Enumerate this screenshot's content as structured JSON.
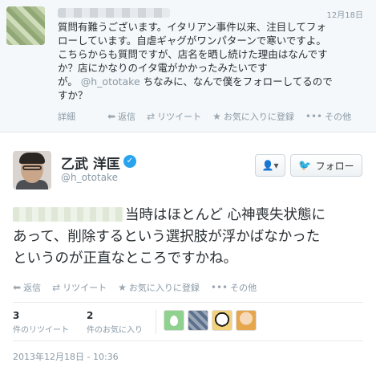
{
  "reply": {
    "date": "12月18日",
    "text_lines": [
      "質問有難うございます。イタリアン事件以来、注目してフォ",
      "ローしています。自虐ギャグがワンパターンで寒いですよ。",
      "こちらからも質問ですが、店名を晒し続けた理由はなんです",
      "か？店にかなりのイタ電がかかったみたいです"
    ],
    "last_line_prefix": "が。",
    "mention": "@h_ototake",
    "last_line_suffix": "ちなみに、なんで僕をフォローしてるので",
    "final_line": "すか？",
    "detail_label": "詳細"
  },
  "actions": {
    "reply": "返信",
    "retweet": "リツイート",
    "favorite": "お気に入りに登録",
    "more": "その他"
  },
  "tweet": {
    "display_name": "乙武 洋匡",
    "screen_name": "@h_ototake",
    "follow_label": "フォロー",
    "user_menu_icon": "person-dropdown-icon",
    "text_lines": [
      "当時はほとんど 心神喪失状態に",
      "あって、削除するという選択肢が浮かばなかった",
      "というのが正直なところですかね。"
    ],
    "retweets_count": "3",
    "retweets_label": "件のリツイート",
    "favorites_count": "2",
    "favorites_label": "件のお気に入り",
    "timestamp": "2013年12月18日 - 10:36"
  },
  "colors": {
    "link": "#2aa3ef",
    "muted": "#8899a6",
    "text": "#292f33"
  }
}
